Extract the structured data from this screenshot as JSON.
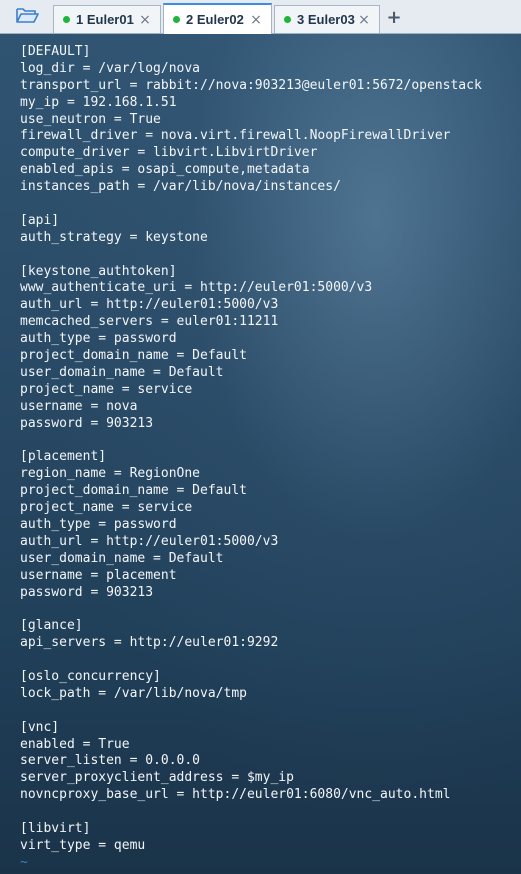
{
  "tabbar": {
    "folder_icon": "folder-icon",
    "tabs": [
      {
        "label": "1 Euler01",
        "status_color": "#1fb43a",
        "active": false
      },
      {
        "label": "2 Euler02",
        "status_color": "#1fb43a",
        "active": true
      },
      {
        "label": "3 Euler03",
        "status_color": "#1fb43a",
        "active": false
      }
    ],
    "close_glyph": "×",
    "add_glyph": "+"
  },
  "terminal": {
    "lines": [
      "[DEFAULT]",
      "log_dir = /var/log/nova",
      "transport_url = rabbit://nova:903213@euler01:5672/openstack",
      "my_ip = 192.168.1.51",
      "use_neutron = True",
      "firewall_driver = nova.virt.firewall.NoopFirewallDriver",
      "compute_driver = libvirt.LibvirtDriver",
      "enabled_apis = osapi_compute,metadata",
      "instances_path = /var/lib/nova/instances/",
      "",
      "[api]",
      "auth_strategy = keystone",
      "",
      "[keystone_authtoken]",
      "www_authenticate_uri = http://euler01:5000/v3",
      "auth_url = http://euler01:5000/v3",
      "memcached_servers = euler01:11211",
      "auth_type = password",
      "project_domain_name = Default",
      "user_domain_name = Default",
      "project_name = service",
      "username = nova",
      "password = 903213",
      "",
      "[placement]",
      "region_name = RegionOne",
      "project_domain_name = Default",
      "project_name = service",
      "auth_type = password",
      "auth_url = http://euler01:5000/v3",
      "user_domain_name = Default",
      "username = placement",
      "password = 903213",
      "",
      "[glance]",
      "api_servers = http://euler01:9292",
      "",
      "[oslo_concurrency]",
      "lock_path = /var/lib/nova/tmp",
      "",
      "[vnc]",
      "enabled = True",
      "server_listen = 0.0.0.0",
      "server_proxyclient_address = $my_ip",
      "novncproxy_base_url = http://euler01:6080/vnc_auto.html",
      "",
      "[libvirt]",
      "virt_type = qemu"
    ],
    "tilde": "~",
    "tilde_color": "#3a7fcf"
  }
}
